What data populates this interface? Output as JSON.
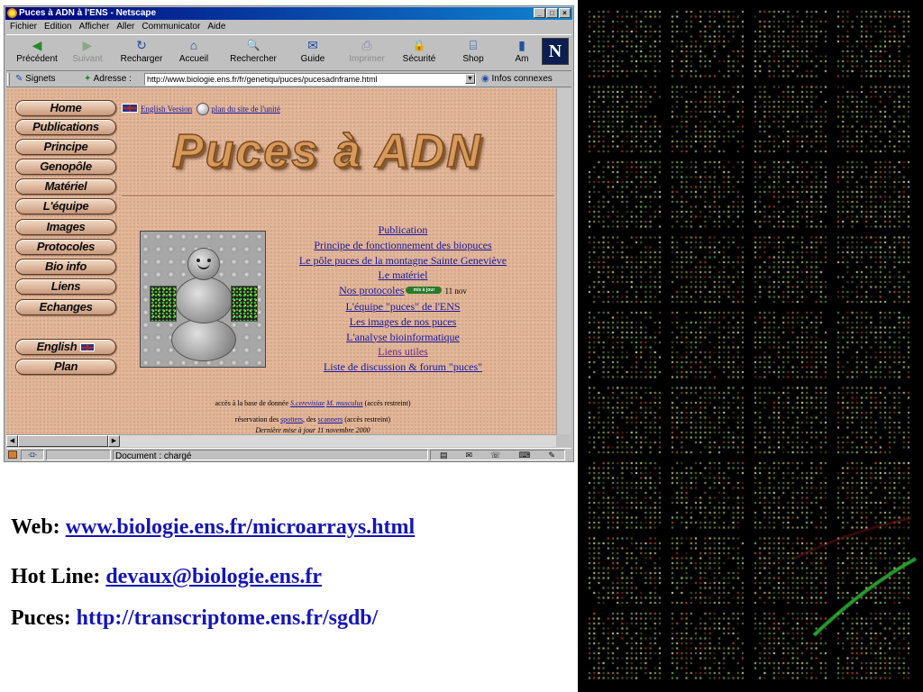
{
  "window": {
    "title": "Puces à ADN à l'ENS - Netscape",
    "controls": [
      "_",
      "□",
      "×"
    ]
  },
  "menubar": [
    "Fichier",
    "Edition",
    "Afficher",
    "Aller",
    "Communicator",
    "Aide"
  ],
  "toolbar": {
    "buttons": [
      {
        "label": "Précédent",
        "icon": "back-arrow-icon",
        "glyph": "◀"
      },
      {
        "label": "Suivant",
        "icon": "forward-arrow-icon",
        "glyph": "▶"
      },
      {
        "label": "Recharger",
        "icon": "reload-icon",
        "glyph": "↻"
      },
      {
        "label": "Accueil",
        "icon": "home-icon",
        "glyph": "⌂"
      },
      {
        "label": "Rechercher",
        "icon": "search-icon",
        "glyph": "🔍"
      },
      {
        "label": "Guide",
        "icon": "guide-icon",
        "glyph": "✉"
      },
      {
        "label": "Imprimer",
        "icon": "print-icon",
        "glyph": "⎙"
      },
      {
        "label": "Sécurité",
        "icon": "lock-icon",
        "glyph": "🔒"
      },
      {
        "label": "Shop",
        "icon": "shop-icon",
        "glyph": "⌸"
      },
      {
        "label": "Am",
        "icon": "bookmark-icon",
        "glyph": "▮"
      }
    ],
    "logo": "N"
  },
  "location": {
    "signets": "Signets",
    "adresse_label": "Adresse :",
    "url": "http://www.biologie.ens.fr/fr/genetiqu/puces/pucesadnframe.html",
    "infos": "Infos connexes"
  },
  "nav": {
    "items": [
      "Home",
      "Publications",
      "Principe",
      "Genopôle",
      "Matériel",
      "L'équipe",
      "Images",
      "Protocoles",
      "Bio info",
      "Liens",
      "Echanges"
    ],
    "english": "English",
    "plan": "Plan"
  },
  "toplinks": {
    "english_version": "English Version",
    "plan_site": "plan du site de l'unité"
  },
  "page_title": "Puces à ADN",
  "menu_links": [
    "Publication",
    "Principe de fonctionnement des biopuces",
    "Le pôle puces de la montagne Sainte Geneviève",
    "Le matériel",
    "Nos protocoles",
    "L'équipe \"puces\" de l'ENS",
    "Les images de nos puces",
    "L'analyse bioinformatique",
    "Liens utiles",
    "Liste de discussion & forum \"puces\""
  ],
  "new_badge": "mis à jour",
  "new_date": "11 nov",
  "footer": {
    "db_prefix": "accès à la base de donnée",
    "db_link1": "S.cerevisiae",
    "db_link2": "M. musculus",
    "db_suffix": "(accès restreint)",
    "res_prefix": "réservation des",
    "res_link1": "spotters",
    "res_mid": ", des",
    "res_link2": "scanners",
    "res_suffix": "(accès restreint)",
    "updated": "Dernière mise à jour  11 novembre 2000"
  },
  "status": {
    "message": "Document : chargé"
  },
  "slide": {
    "web_label": "Web:",
    "web_url": "www.biologie.ens.fr/microarrays.html",
    "hotline_label": "Hot Line:",
    "hotline_email": "devaux@biologie.ens.fr",
    "puces_label": "Puces:",
    "puces_url": "http://transcriptome.ens.fr/sgdb/",
    "puces_trailing": " "
  },
  "microarray": {
    "grid_columns": 4,
    "grid_rows": 9,
    "spot_colors": [
      "#e8e890",
      "#bfe07a",
      "#7fd85a",
      "#f0f0c8",
      "#d84a3a",
      "#c8c050"
    ],
    "background": "#000000"
  }
}
